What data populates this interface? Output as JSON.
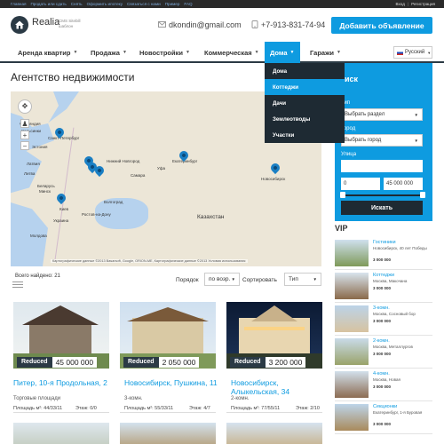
{
  "topbar": {
    "links": [
      "Главная",
      "Продать или сдать",
      "Снять",
      "Оформить ипотеку",
      "Связаться с нами",
      "Пример",
      "FAQ"
    ],
    "login": "Вход",
    "sep": "|",
    "register": "Регистрация"
  },
  "header": {
    "logo_name": "Realia",
    "logo_sub1": "CMS Sitebill",
    "logo_sub2": "шаблон",
    "email": "dkondin@gmail.com",
    "phone": "+7-913-831-74-94",
    "add_button": "Добавить объявление"
  },
  "nav": {
    "items": [
      "Аренда квартир",
      "Продажа",
      "Новостройки",
      "Коммерческая",
      "Дома",
      "Гаражи"
    ],
    "language": "Русский"
  },
  "dropdown": {
    "items": [
      "Дома",
      "Коттеджи",
      "Дачи",
      "Землеотводы",
      "Участки"
    ]
  },
  "main": {
    "title": "Агентство недвижимости",
    "found": "Всего найдено: 21",
    "order_label": "Порядок",
    "order_value": "по возр.",
    "sort_label": "Сортировать",
    "sort_value": "Тип"
  },
  "map": {
    "labels": [
      "Финляндия",
      "Хельсинки",
      "Санкт-Петербург",
      "Эстония",
      "Латвия",
      "Литва",
      "Беларусь",
      "Минск",
      "Украина",
      "Киев",
      "Молдова",
      "Казахстан",
      "Ростов-на-Дону",
      "Волгоград",
      "Самара",
      "Уфа",
      "Екатеринбург",
      "Нижний Новгород",
      "Новосибирск"
    ],
    "credit": "Картографические данные ©2013 Basarsoft, Google, ORION-ME, Картографические данные ©2013 Условия использования"
  },
  "search": {
    "type_label": "Тип",
    "type_value": "Выбрать раздел",
    "city_label": "Город",
    "city_value": "Выбрать город",
    "street_label": "Улица",
    "price_from": "0",
    "price_to": "45 000 000",
    "button": "Искать"
  },
  "cards": [
    {
      "badge": "Reduced",
      "price": "45 000 000",
      "title": "Питер, 10-я Продольная, 2",
      "sub": "Торговые площади",
      "area": "Площадь м²: 44/33/11",
      "floor": "Этаж: 0/0"
    },
    {
      "badge": "Reduced",
      "price": "2 050 000",
      "title": "Новосибирск, Пушкина, 11",
      "sub": "3-комн.",
      "area": "Площадь м²: 55/33/11",
      "floor": "Этаж: 4/7"
    },
    {
      "badge": "Reduced",
      "price": "3 200 000",
      "title": "Новосибирск, Алыкельская, 34",
      "sub": "2-комн.",
      "area": "Площадь м²: 77/55/11",
      "floor": "Этаж: 2/10"
    }
  ],
  "vip": {
    "title": "VIP",
    "items": [
      {
        "name": "Гостиники",
        "sub": "Новосибирск, 40 лет Победы",
        "price": "3 000 000"
      },
      {
        "name": "Коттеджи",
        "sub": "Москва, Макочана",
        "price": "3 000 000"
      },
      {
        "name": "3-комн.",
        "sub": "Москва, Сосновый бор",
        "price": "3 000 000"
      },
      {
        "name": "2-комн.",
        "sub": "Москва, Металлургов",
        "price": "3 000 000"
      },
      {
        "name": "4-комн.",
        "sub": "Москва, Новая",
        "price": "3 000 000"
      },
      {
        "name": "Секционки",
        "sub": "Екатеринбург, 1-я Буровая",
        "price": "3 000 000"
      }
    ]
  }
}
